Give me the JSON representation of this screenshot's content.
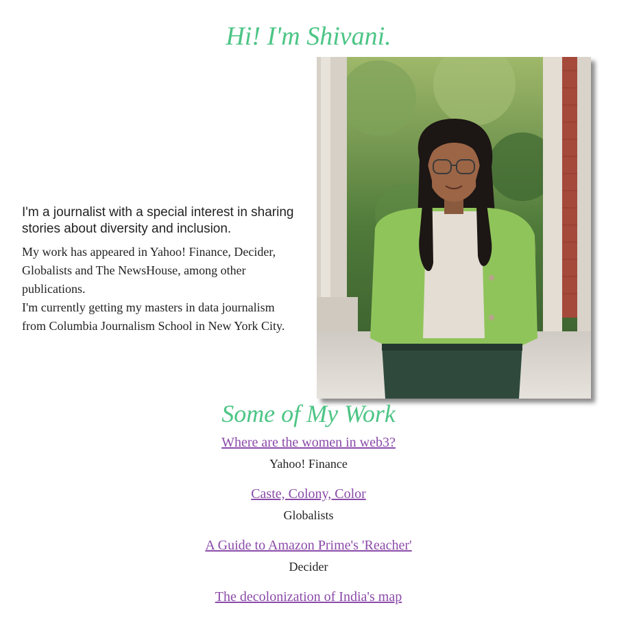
{
  "header": {
    "title": "Hi! I'm Shivani."
  },
  "intro": {
    "lead": "I'm a journalist with a special interest in sharing stories about diversity and inclusion.",
    "paragraph_1": "My work has appeared in Yahoo! Finance, Decider, Globalists and The NewsHouse, among other publications.",
    "paragraph_2": "I'm currently getting my masters in data journalism from Columbia Journalism School in New York City."
  },
  "portrait": {
    "icon": "profile-photo"
  },
  "work": {
    "title": "Some of My Work",
    "items": [
      {
        "title": "Where are the women in web3?",
        "outlet": "Yahoo! Finance"
      },
      {
        "title": "Caste, Colony, Color",
        "outlet": "Globalists"
      },
      {
        "title": "A Guide to Amazon Prime's 'Reacher'",
        "outlet": "Decider"
      },
      {
        "title": "The decolonization of India's map",
        "outlet": ""
      }
    ]
  },
  "colors": {
    "heading_green": "#4cc585",
    "link_purple": "#8a4aa8",
    "cardigan_green": "#8fc45a"
  }
}
